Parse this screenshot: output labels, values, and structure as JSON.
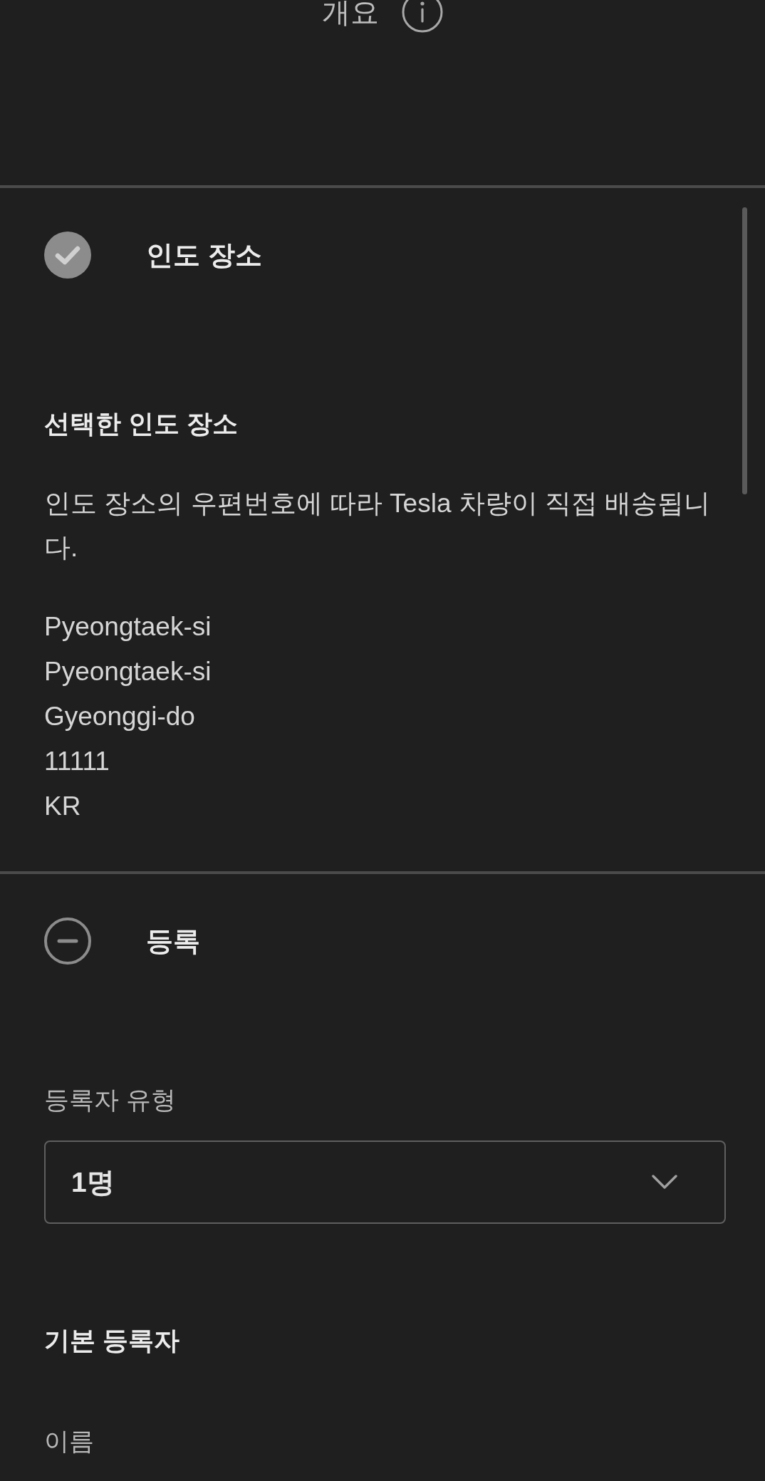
{
  "header": {
    "title": "개요"
  },
  "sections": [
    {
      "title": "인도 장소",
      "completed": true,
      "blocks": [
        {
          "kind": "subheading",
          "text": "선택한 인도 장소"
        },
        {
          "kind": "paragraph",
          "text": "인도 장소의 우편번호에 따라 Tesla 차량이 직접 배송됩니다."
        },
        {
          "kind": "address",
          "lines": [
            "Pyeongtaek-si",
            "Pyeongtaek-si",
            "Gyeonggi-do",
            "11111",
            "KR"
          ]
        }
      ]
    },
    {
      "title": "등록",
      "completed": false,
      "blocks": [
        {
          "kind": "select",
          "label": "등록자 유형",
          "value": "1명"
        },
        {
          "kind": "subheading",
          "text": "기본 등록자"
        },
        {
          "kind": "field_label",
          "text": "이름"
        }
      ]
    }
  ]
}
